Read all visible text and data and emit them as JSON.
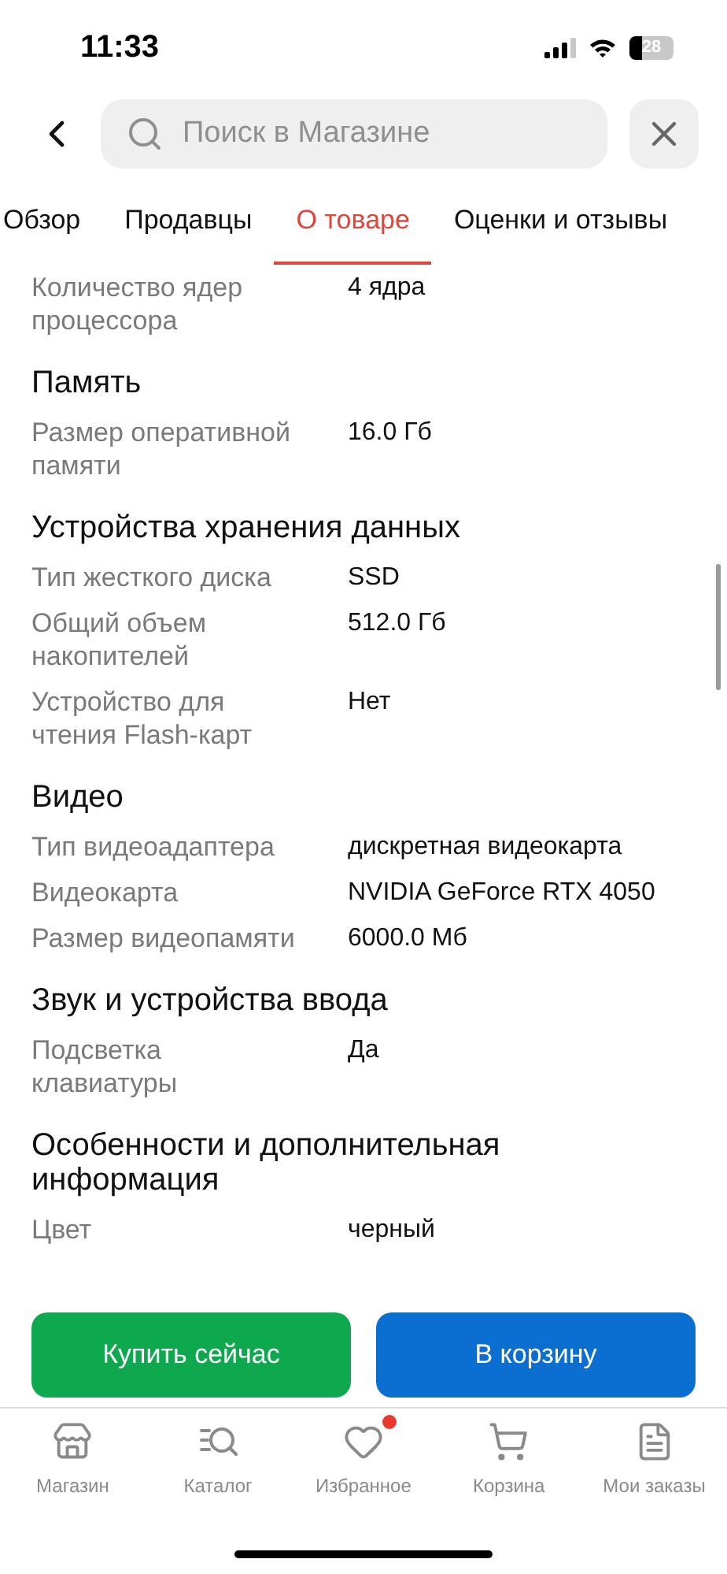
{
  "status_bar": {
    "time": "11:33",
    "battery": "28"
  },
  "search": {
    "placeholder": "Поиск в Магазине"
  },
  "tabs": [
    {
      "label": "Обзор",
      "selected": false
    },
    {
      "label": "Продавцы",
      "selected": false
    },
    {
      "label": "О товаре",
      "selected": true
    },
    {
      "label": "Оценки и отзывы",
      "selected": false
    }
  ],
  "specs": [
    {
      "rows": [
        {
          "label": "Количество ядер процессора",
          "value": "4 ядра"
        }
      ]
    },
    {
      "title": "Память",
      "rows": [
        {
          "label": "Размер оперативной памяти",
          "value": "16.0 Гб"
        }
      ]
    },
    {
      "title": "Устройства хранения данных",
      "rows": [
        {
          "label": "Тип жесткого диска",
          "value": "SSD"
        },
        {
          "label": "Общий объем накопителей",
          "value": "512.0 Гб"
        },
        {
          "label": "Устройство для чтения Flash-карт",
          "value": "Нет"
        }
      ]
    },
    {
      "title": "Видео",
      "rows": [
        {
          "label": "Тип видеоадаптера",
          "value": "дискретная видеокарта"
        },
        {
          "label": "Видеокарта",
          "value": "NVIDIA GeForce RTX 4050"
        },
        {
          "label": "Размер видеопамяти",
          "value": "6000.0 Мб"
        }
      ]
    },
    {
      "title": "Звук и устройства ввода",
      "rows": [
        {
          "label": "Подсветка клавиатуры",
          "value": "Да"
        }
      ]
    },
    {
      "title": "Особенности и дополнительная информация",
      "rows": [
        {
          "label": "Цвет",
          "value": "черный"
        }
      ]
    }
  ],
  "actions": [
    {
      "label": "Купить сейчас",
      "kind": "buy"
    },
    {
      "label": "В корзину",
      "kind": "cart"
    }
  ],
  "nav": [
    {
      "label": "Магазин",
      "kind": "store",
      "badge": false
    },
    {
      "label": "Каталог",
      "kind": "catalog",
      "badge": false
    },
    {
      "label": "Избранное",
      "kind": "favorites",
      "badge": true
    },
    {
      "label": "Корзина",
      "kind": "cart",
      "badge": false
    },
    {
      "label": "Мои заказы",
      "kind": "orders",
      "badge": false
    }
  ]
}
